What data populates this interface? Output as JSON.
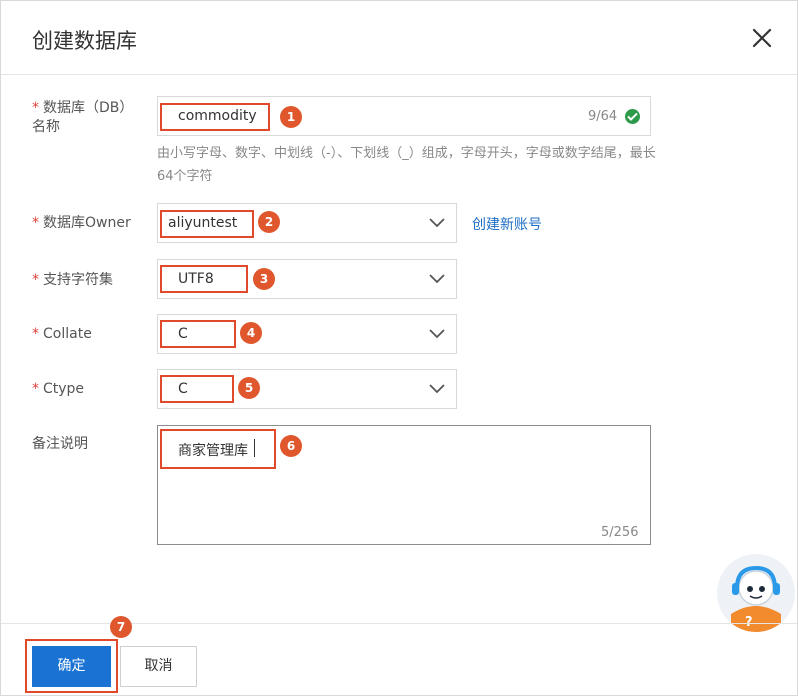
{
  "dialog": {
    "title": "创建数据库"
  },
  "form": {
    "db_name": {
      "label": "数据库（DB）名称",
      "value": "commodity",
      "counter": "9/64",
      "hint": "由小写字母、数字、中划线（-）、下划线（_）组成，字母开头，字母或数字结尾，最长64个字符"
    },
    "owner": {
      "label": "数据库Owner",
      "value": "aliyuntest",
      "create_link": "创建新账号"
    },
    "charset": {
      "label": "支持字符集",
      "value": "UTF8"
    },
    "collate": {
      "label": "Collate",
      "value": "C"
    },
    "ctype": {
      "label": "Ctype",
      "value": "C"
    },
    "remark": {
      "label": "备注说明",
      "value": "商家管理库",
      "counter": "5/256"
    }
  },
  "footer": {
    "ok_label": "确定",
    "cancel_label": "取消"
  },
  "annotations": [
    "1",
    "2",
    "3",
    "4",
    "5",
    "6",
    "7"
  ],
  "colors": {
    "primary": "#1a73d3",
    "highlight": "#e04a2a",
    "badge": "#e0572e",
    "required": "#e0403a",
    "success": "#2f9b4a",
    "link": "#1f6fc5"
  },
  "icons": {
    "close": "close-icon",
    "dropdown": "chevron-down-icon",
    "valid": "check-circle-icon",
    "assistant": "assistant-avatar-icon"
  }
}
